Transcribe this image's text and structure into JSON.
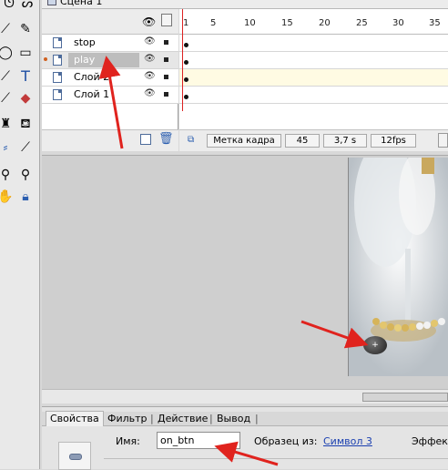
{
  "scene": {
    "title": "Сцена 1"
  },
  "timeline": {
    "layers": [
      {
        "name": "stop",
        "selected": false
      },
      {
        "name": "play",
        "selected": true
      },
      {
        "name": "Слой 2",
        "selected": false
      },
      {
        "name": "Слой 1",
        "selected": false
      }
    ],
    "ruler_ticks": [
      "1",
      "5",
      "10",
      "15",
      "20",
      "25",
      "30",
      "35"
    ],
    "footer": {
      "frame_label": "Метка кадра",
      "current_frame": "45",
      "time": "3,7 s",
      "fps": "12fps"
    }
  },
  "properties": {
    "tabs": [
      "Свойства",
      "Фильтр",
      "Действие",
      "Вывод"
    ],
    "name_label": "Имя:",
    "name_value": "on_btn",
    "source_label": "Образец из:",
    "source_link": "Символ 3",
    "effect_label": "Эффект"
  },
  "icons": [
    "pencil-icon",
    "arrow-icon",
    "oval-icon",
    "rectangle-icon",
    "text-icon",
    "lasso-icon",
    "eraser-icon",
    "brush-icon",
    "ink-bottle-icon",
    "paint-bucket-icon",
    "eyedropper-icon",
    "zoom-icon",
    "hand-icon",
    "lock-icon",
    "eye-icon",
    "lock-column-icon",
    "outline-icon",
    "add-layer-icon",
    "trash-icon",
    "onion-skin-icon",
    "play-button-icon"
  ],
  "colors": {
    "arrow": "#e0231e",
    "playhead": "#d22222",
    "link": "#1a3fb0"
  }
}
